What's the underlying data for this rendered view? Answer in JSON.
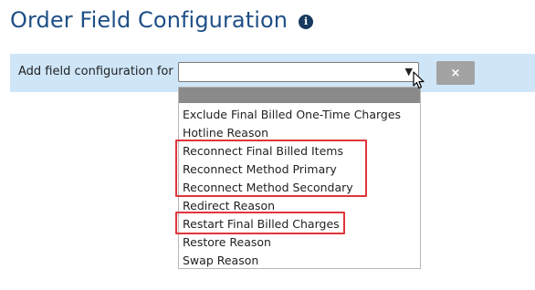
{
  "page": {
    "title": "Order Field Configuration",
    "info_icon": "info-icon"
  },
  "config_bar": {
    "label": "Add field configuration for",
    "select_value": "",
    "clear_button_label": "×"
  },
  "dropdown": {
    "options": [
      {
        "label": "Exclude Final Billed One-Time Charges"
      },
      {
        "label": "Hotline Reason"
      },
      {
        "label": "Reconnect Final Billed Items"
      },
      {
        "label": "Reconnect Method Primary"
      },
      {
        "label": "Reconnect Method Secondary"
      },
      {
        "label": "Redirect Reason"
      },
      {
        "label": "Restart Final Billed Charges"
      },
      {
        "label": "Restore Reason"
      },
      {
        "label": "Swap Reason"
      }
    ]
  },
  "colors": {
    "title": "#1e4f86",
    "bar_background": "#cfe6f8",
    "highlight": "#e0353b",
    "clear_button": "#a3a3a3"
  }
}
